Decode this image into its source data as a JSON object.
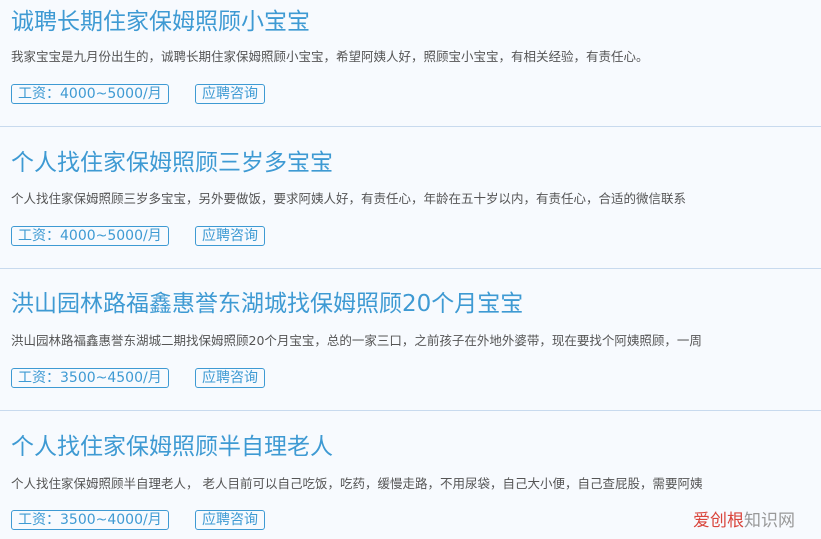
{
  "listings": [
    {
      "title": "诚聘长期住家保姆照顾小宝宝",
      "description": "我家宝宝是九月份出生的，诚聘长期住家保姆照顾小宝宝，希望阿姨人好，照顾宝小宝宝，有相关经验，有责任心。",
      "salary": "工资：4000~5000/月",
      "consult": "应聘咨询"
    },
    {
      "title": "个人找住家保姆照顾三岁多宝宝",
      "description": "个人找住家保姆照顾三岁多宝宝，另外要做饭，要求阿姨人好，有责任心，年龄在五十岁以内，有责任心，合适的微信联系",
      "salary": "工资：4000~5000/月",
      "consult": "应聘咨询"
    },
    {
      "title": "洪山园林路福鑫惠誉东湖城找保姆照顾20个月宝宝",
      "description": "洪山园林路福鑫惠誉东湖城二期找保姆照顾20个月宝宝，总的一家三口，之前孩子在外地外婆带，现在要找个阿姨照顾，一周",
      "salary": "工资：3500~4500/月",
      "consult": "应聘咨询"
    },
    {
      "title": "个人找住家保姆照顾半自理老人",
      "description": "个人找住家保姆照顾半自理老人， 老人目前可以自己吃饭，吃药，缓慢走路，不用尿袋，自己大小便，自己查屁股，需要阿姨",
      "salary": "工资：3500~4000/月",
      "consult": "应聘咨询"
    }
  ],
  "watermark": {
    "red_part": "爱创根",
    "gray_part": "知识网"
  }
}
